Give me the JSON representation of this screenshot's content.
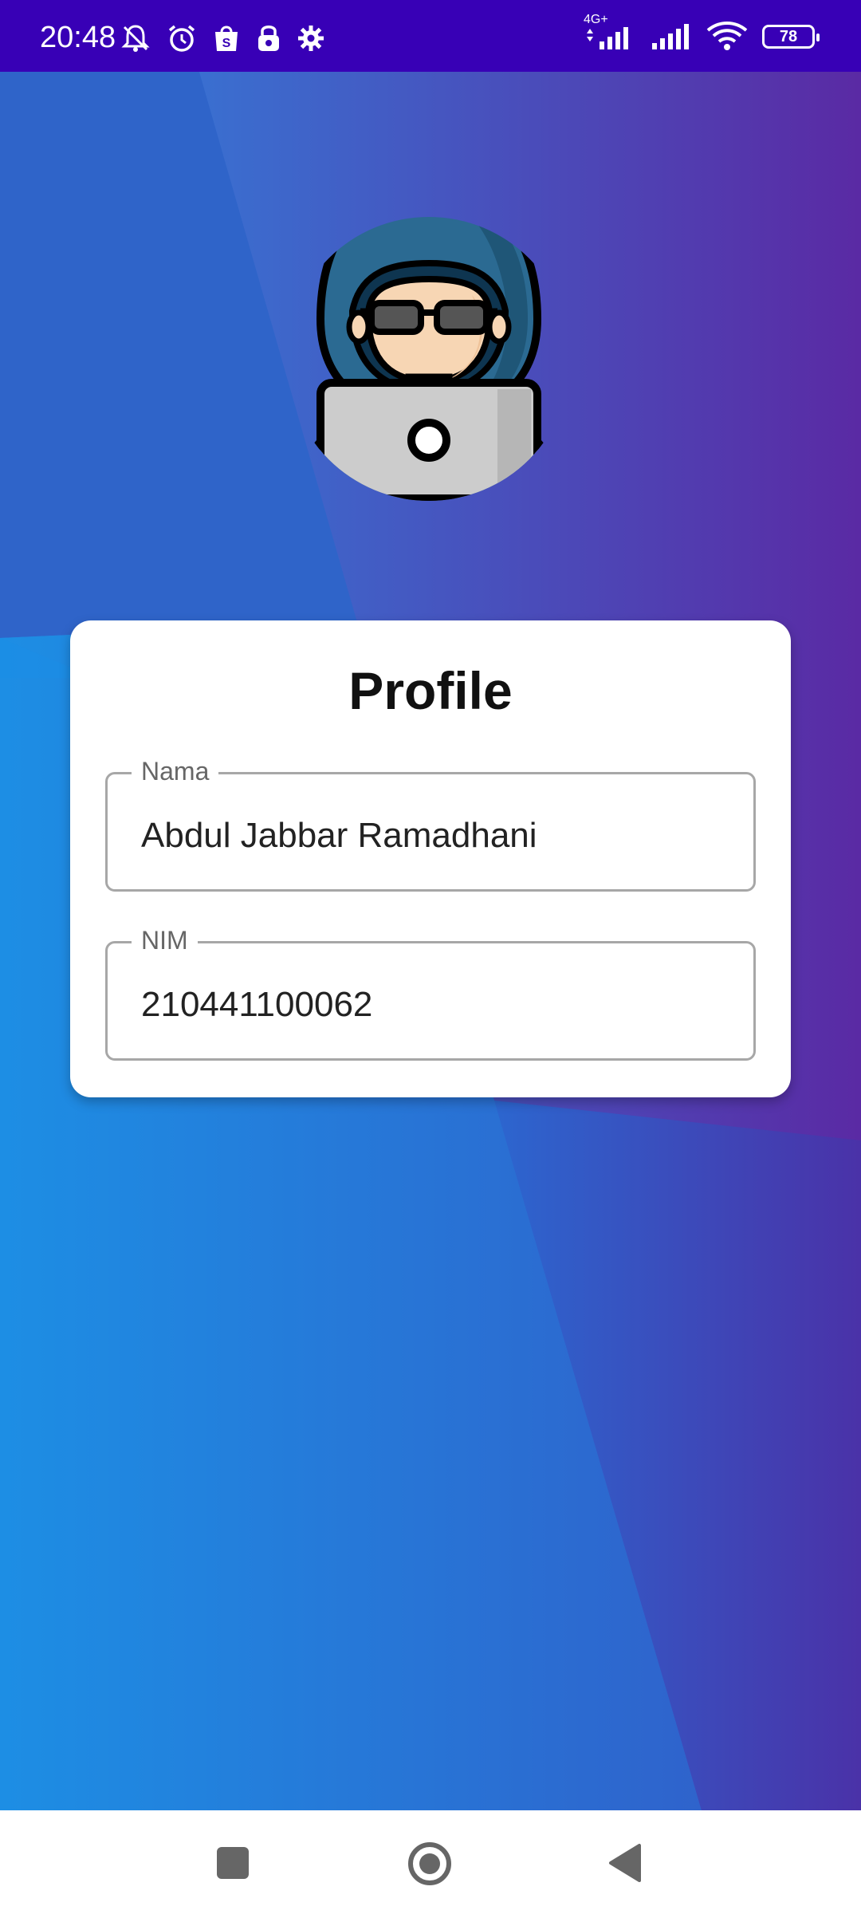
{
  "status_bar": {
    "time": "20:48",
    "left_icons": [
      "notifications-off-icon",
      "alarm-icon",
      "shopee-icon",
      "vpn-lock-icon",
      "settings-gear-icon"
    ],
    "network_label": "4G+",
    "right_icons": [
      "mobile-data-icon",
      "signal-icon",
      "signal-icon",
      "wifi-icon"
    ],
    "battery_level": "78"
  },
  "avatar": {
    "icon": "hacker-avatar-icon"
  },
  "profile_card": {
    "title": "Profile",
    "fields": [
      {
        "label": "Nama",
        "value": "Abdul Jabbar Ramadhani"
      },
      {
        "label": "NIM",
        "value": "210441100062"
      }
    ]
  },
  "nav_bar": {
    "buttons": [
      "recents-button",
      "home-button",
      "back-button"
    ]
  },
  "colors": {
    "status_bar": "#3800b6",
    "bg_blue": "#1f8ae0",
    "bg_purple": "#5a2aa4",
    "card": "#ffffff"
  }
}
